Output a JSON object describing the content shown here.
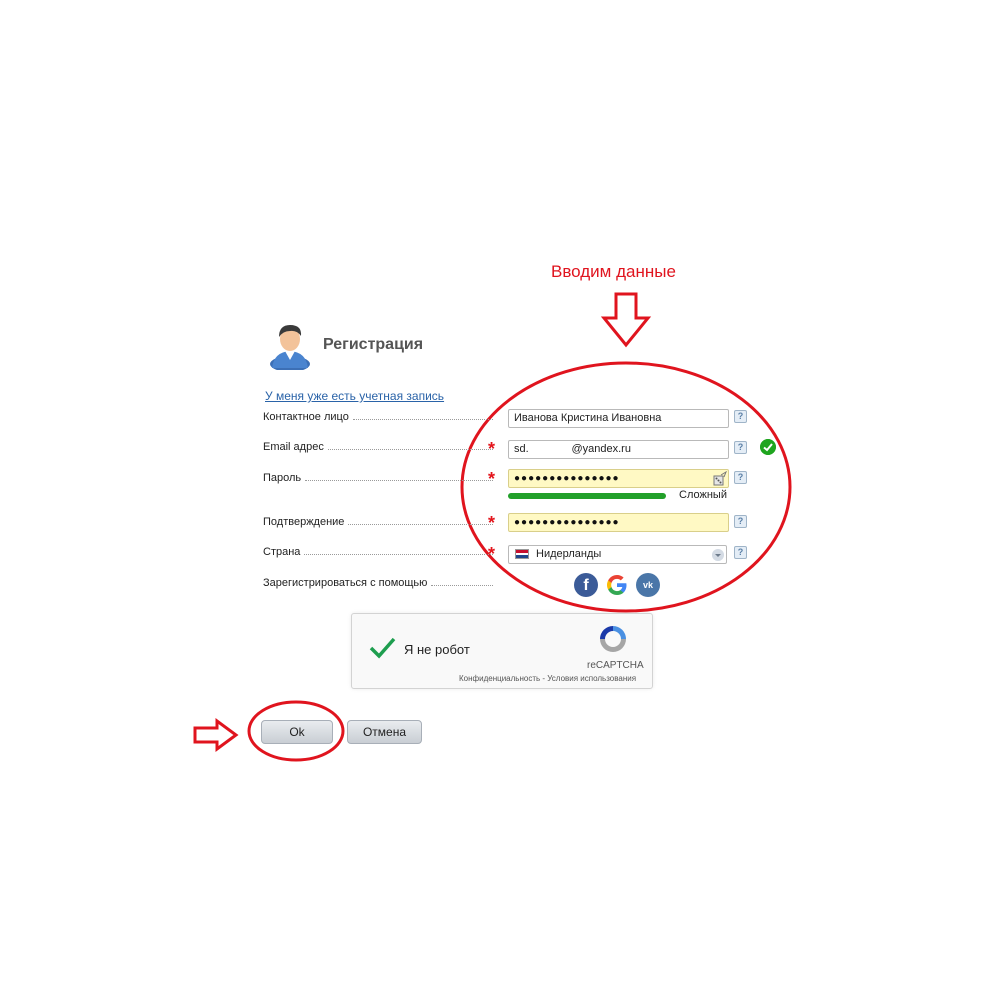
{
  "annotation": {
    "text": "Вводим данные",
    "color": "#e0141e"
  },
  "header": {
    "title": "Регистрация",
    "icon": "user-avatar-icon"
  },
  "login_link": "У меня уже есть учетная запись",
  "fields": {
    "contact": {
      "label": "Контактное лицо",
      "value": "Иванова Кристина Ивановна"
    },
    "email": {
      "label": "Email адрес",
      "value": "sd.              @yandex.ru",
      "status": "valid"
    },
    "password": {
      "label": "Пароль",
      "masked": "●●●●●●●●●●●●●●●",
      "strength": "Сложный",
      "strength_fraction": 1.0
    },
    "confirm": {
      "label": "Подтверждение",
      "masked": "●●●●●●●●●●●●●●●"
    },
    "country": {
      "label": "Страна",
      "value": "Нидерланды",
      "flag": "netherlands-flag"
    },
    "social": {
      "label": "Зарегистрироваться с помощью",
      "providers": [
        "facebook",
        "google",
        "vk"
      ]
    }
  },
  "required_mark": "*",
  "help_mark": "?",
  "captcha": {
    "label": "Я не робот",
    "brand": "reCAPTCHA",
    "links": "Конфиденциальность - Условия использования"
  },
  "buttons": {
    "ok": "Ok",
    "cancel": "Отмена"
  },
  "colors": {
    "accent": "#e0141e",
    "strength": "#22a02a",
    "link": "#2a63a8",
    "valid": "#1fa51f"
  }
}
